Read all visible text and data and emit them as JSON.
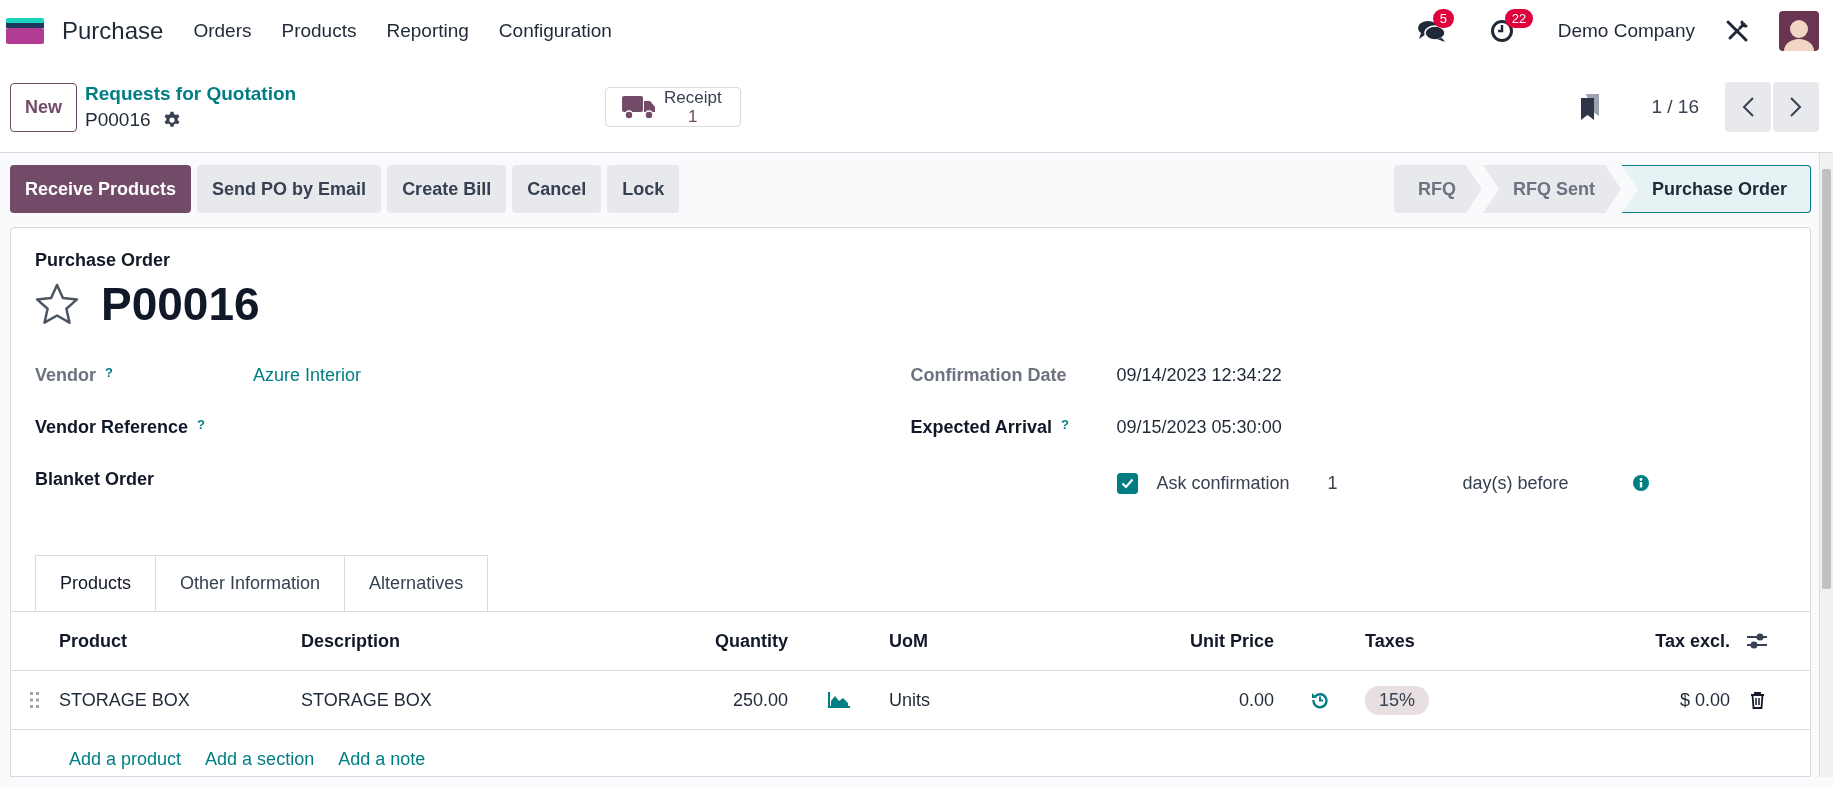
{
  "navbar": {
    "app_name": "Purchase",
    "menu": [
      "Orders",
      "Products",
      "Reporting",
      "Configuration"
    ],
    "messages_count": "5",
    "activities_count": "22",
    "company": "Demo Company"
  },
  "control_panel": {
    "new_button": "New",
    "breadcrumb": "Requests for Quotation",
    "record": "P00016",
    "smart_button": {
      "label": "Receipt",
      "count": "1"
    },
    "pager": "1 / 16"
  },
  "actions": [
    {
      "label": "Receive Products",
      "primary": true
    },
    {
      "label": "Send PO by Email",
      "primary": false
    },
    {
      "label": "Create Bill",
      "primary": false
    },
    {
      "label": "Cancel",
      "primary": false
    },
    {
      "label": "Lock",
      "primary": false
    }
  ],
  "status_steps": [
    {
      "label": "RFQ",
      "selected": false
    },
    {
      "label": "RFQ Sent",
      "selected": false
    },
    {
      "label": "Purchase Order",
      "selected": true
    }
  ],
  "form": {
    "title": "Purchase Order",
    "name": "P00016",
    "starred": false,
    "left_fields": [
      {
        "label": "Vendor",
        "help": "?",
        "value": "Azure Interior",
        "muted": true
      },
      {
        "label": "Vendor Reference",
        "help": "?",
        "muted": false
      },
      {
        "label": "Blanket Order",
        "muted": false
      }
    ],
    "right_fields": [
      {
        "label": "Confirmation Date",
        "value": "09/14/2023 12:34:22",
        "muted": true
      },
      {
        "label": "Expected Arrival",
        "help": "?",
        "value": "09/15/2023 05:30:00",
        "muted": false
      }
    ],
    "ask_confirmation": {
      "checked": true,
      "label": "Ask confirmation",
      "days": "1",
      "suffix": "day(s) before"
    }
  },
  "tabs": [
    {
      "label": "Products",
      "selected": true
    },
    {
      "label": "Other Information",
      "selected": false
    },
    {
      "label": "Alternatives",
      "selected": false
    }
  ],
  "table": {
    "columns": [
      "Product",
      "Description",
      "Quantity",
      "UoM",
      "Unit Price",
      "Taxes",
      "Tax excl."
    ],
    "rows": [
      {
        "product": "STORAGE BOX",
        "description": "STORAGE BOX",
        "quantity": "250.00",
        "uom": "Units",
        "unit_price": "0.00",
        "taxes": "15%",
        "tax_excl": "$ 0.00"
      }
    ],
    "add_links": [
      "Add a product",
      "Add a section",
      "Add a note"
    ]
  }
}
